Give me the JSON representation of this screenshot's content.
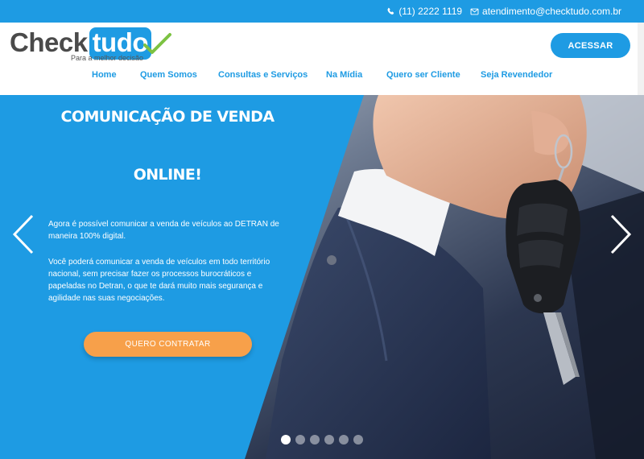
{
  "topbar": {
    "phone": "(11) 2222 1119",
    "email": "atendimento@checktudo.com.br",
    "phone_icon": "phone-icon",
    "email_icon": "envelope-icon"
  },
  "header": {
    "logo_text_check": "Check",
    "logo_text_tudo": "tudo",
    "tagline": "Para a melhor decisão",
    "access_button": "ACESSAR"
  },
  "nav": {
    "items": [
      {
        "label": "Home"
      },
      {
        "label": "Quem Somos"
      },
      {
        "label": "Consultas e Serviços"
      },
      {
        "label": "Na Mídia"
      },
      {
        "label": "Quero ser Cliente"
      },
      {
        "label": "Seja Revendedor"
      }
    ]
  },
  "hero": {
    "title_line1": "COMUNICAÇÃO DE VENDA",
    "title_line2": "ONLINE!",
    "paragraph1": "Agora é possível comunicar a venda de veículos ao DETRAN de maneira 100% digital.",
    "paragraph2": "Você poderá comunicar a venda de veículos em todo território nacional, sem precisar fazer os processos burocráticos e papeladas no Detran, o que te dará muito mais segurança e agilidade nas suas negociações.",
    "cta": "QUERO CONTRATAR",
    "slides_total": 6,
    "active_slide": 1
  },
  "colors": {
    "brand_blue": "#1e9be3",
    "cta_orange": "#f7a04a",
    "check_green": "#7cc242"
  }
}
